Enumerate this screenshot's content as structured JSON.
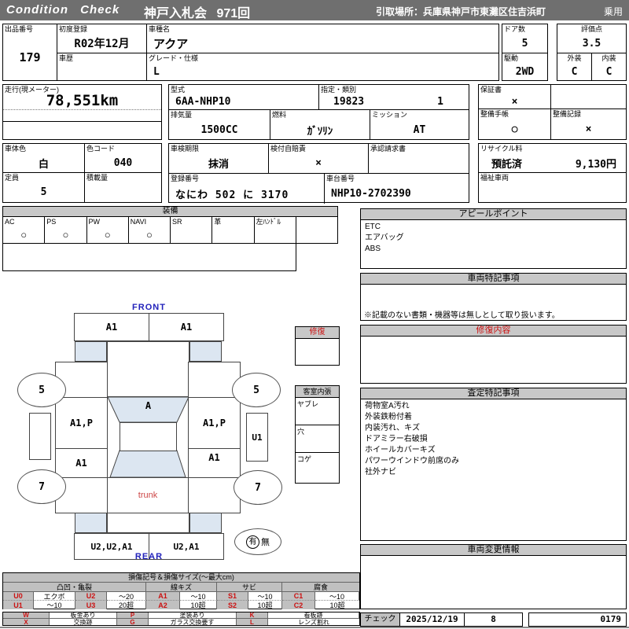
{
  "header": {
    "logo": "Condition Check",
    "auction": "神戸入札会 971回",
    "pickup": "引取場所：兵庫県神戸市東灘区住吉浜町",
    "usage": "乗用"
  },
  "info": {
    "lot_label": "出品番号",
    "lot": "179",
    "first_reg_label": "初度登録",
    "first_reg": "R02年12月",
    "model_name_label": "車種名",
    "model_name": "アクア",
    "history_label": "車歴",
    "history": "",
    "grade_label": "グレード・仕様",
    "grade": "L",
    "doors_label": "ドア数",
    "doors": "5",
    "drive_label": "駆動",
    "drive": "2WD",
    "score_label": "評価点",
    "score": "3.5",
    "exterior_label": "外装",
    "exterior": "C",
    "interior_label": "内装",
    "interior": "C"
  },
  "spec": {
    "mileage_label": "走行(現メーター)",
    "mileage": "78,551km",
    "model_code_label": "型式",
    "model_code": "6AA-NHP10",
    "class_label": "指定・類別",
    "class_no": "19823",
    "class_sub": "1",
    "displacement_label": "排気量",
    "displacement": "1500CC",
    "fuel_label": "燃料",
    "fuel": "ｶﾞｿﾘﾝ",
    "mission_label": "ミッション",
    "mission": "AT",
    "warranty_label": "保証書",
    "warranty": "×",
    "maintenance_book_label": "整備手帳",
    "maintenance_book": "○",
    "maintenance_record_label": "整備記録",
    "maintenance_record": "×"
  },
  "reg": {
    "color_label": "車体色",
    "color": "白",
    "color_code_label": "色コード",
    "color_code": "040",
    "inspection_label": "車検期限",
    "inspection": "抹消",
    "insurance_label": "検付自賠責",
    "insurance": "×",
    "approval_label": "承認請求書",
    "approval": "",
    "recycle_label": "リサイクル料",
    "recycle_status": "預託済",
    "recycle_fee": "9,130円",
    "capacity_label": "定員",
    "capacity": "5",
    "load_label": "積載量",
    "load": "",
    "plate_label": "登録番号",
    "plate": "なにわ 502 に 3170",
    "vin_label": "車台番号",
    "vin": "NHP10-2702390",
    "welfare_label": "福祉車両",
    "welfare": ""
  },
  "equipment": {
    "title": "装備",
    "items": [
      {
        "label": "AC",
        "value": "○"
      },
      {
        "label": "PS",
        "value": "○"
      },
      {
        "label": "PW",
        "value": "○"
      },
      {
        "label": "NAVI",
        "value": "○"
      },
      {
        "label": "SR",
        "value": ""
      },
      {
        "label": "革",
        "value": ""
      },
      {
        "label": "左ﾊﾝﾄﾞﾙ",
        "value": ""
      },
      {
        "label": "",
        "value": ""
      }
    ]
  },
  "appeal": {
    "title": "アピールポイント",
    "items": [
      "ETC",
      "エアバッグ",
      "ABS"
    ]
  },
  "notes": {
    "title": "車両特記事項",
    "note": "※記載のない書類・機器等は無しとして取り扱います。"
  },
  "repair": {
    "title": "修復内容"
  },
  "assessment": {
    "title": "査定特記事項",
    "items": [
      "荷物室A汚れ",
      "外装鉄粉付着",
      "内装汚れ、キズ",
      "ドアミラー右破損",
      "ホイールカバーキズ",
      "パワーウインドウ前席のみ",
      "社外ナビ"
    ]
  },
  "change_info": {
    "title": "車両変更情報"
  },
  "check": {
    "label": "チェック",
    "date": "2025/12/19",
    "number": "8",
    "code": "0179"
  },
  "diagram": {
    "front_label": "FRONT",
    "rear_label": "REAR",
    "trunk_label": "trunk",
    "front_bumper_left": "A1",
    "front_bumper_right": "A1",
    "left_front_door": "A1,P",
    "left_rear_door": "A1",
    "right_front_door": "A1,P",
    "right_rear_door": "A1",
    "windshield_mark": "A",
    "right_sill_mark": "U1",
    "rear_bumper_left": "U2,U2,A1",
    "rear_bumper_right": "U2,A1",
    "wheel_front_left": "5",
    "wheel_front_right": "5",
    "wheel_rear_left": "7",
    "wheel_rear_right": "7",
    "presence_yes": "有",
    "presence_no": "無",
    "repair_box_title": "修復",
    "interior_box_title": "客室内張",
    "interior_rows": [
      "ヤブレ",
      "穴",
      "コゲ"
    ]
  },
  "legend": {
    "title": "損傷記号＆損傷サイズ(〜最大cm)",
    "categories": [
      "凸凹・亀裂",
      "線キズ",
      "サビ",
      "腐食"
    ],
    "row1": [
      {
        "code": "U0",
        "val": "エクボ"
      },
      {
        "code": "U2",
        "val": "〜20"
      },
      {
        "code": "A1",
        "val": "〜10"
      },
      {
        "code": "S1",
        "val": "〜10"
      },
      {
        "code": "C1",
        "val": "〜10"
      }
    ],
    "row2": [
      {
        "code": "U1",
        "val": "〜10"
      },
      {
        "code": "U3",
        "val": "20超"
      },
      {
        "code": "A2",
        "val": "10超"
      },
      {
        "code": "S2",
        "val": "10超"
      },
      {
        "code": "C2",
        "val": "10超"
      }
    ],
    "marks_row1": [
      {
        "code": "W",
        "val": "板金あり"
      },
      {
        "code": "P",
        "val": "塗装あり"
      },
      {
        "code": "K",
        "val": "看板跡"
      }
    ],
    "marks_row2": [
      {
        "code": "X",
        "val": "交換跡"
      },
      {
        "code": "G",
        "val": "ガラス交換要す"
      },
      {
        "code": "L",
        "val": "レンズ割れ"
      }
    ]
  },
  "colors": {
    "bar_gray": "#6f6f6f",
    "header_gray": "#c8c8c8",
    "highlight_blue": "#dce6f1",
    "direction_blue": "#2222bb",
    "warning_red": "#cc1111"
  }
}
